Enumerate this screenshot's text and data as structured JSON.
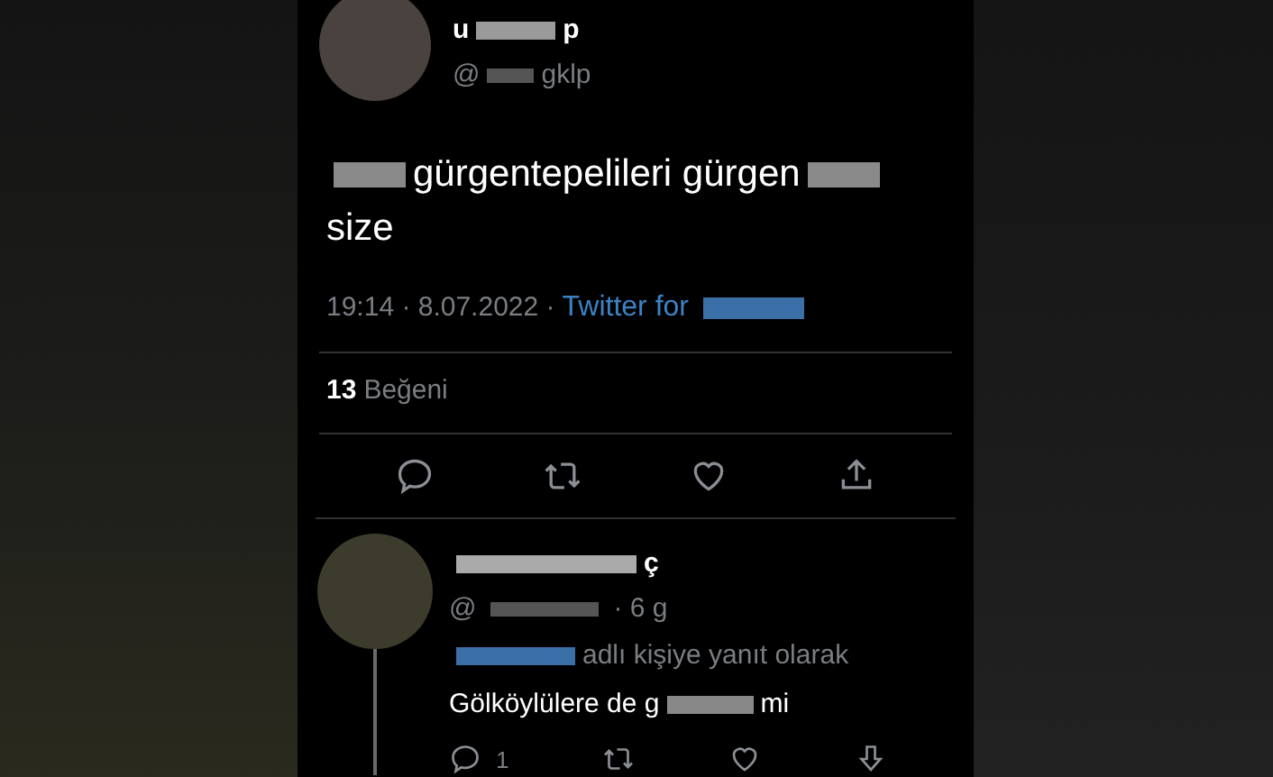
{
  "tweet": {
    "author": {
      "name": [
        {
          "kind": "text",
          "text": "u"
        },
        {
          "kind": "censor"
        },
        {
          "kind": "text",
          "text": "p"
        }
      ],
      "handle": [
        {
          "kind": "text",
          "text": "@"
        },
        {
          "kind": "censor"
        },
        {
          "kind": "text",
          "text": "gklp"
        }
      ]
    },
    "body": [
      {
        "kind": "censor"
      },
      {
        "kind": "text",
        "text": "gürgentepelileri gürgen"
      },
      {
        "kind": "censor"
      },
      {
        "kind": "break"
      },
      {
        "kind": "text",
        "text": "size"
      }
    ],
    "time": "19:14 · 8.07.2022 ·",
    "source": [
      {
        "kind": "link",
        "text": "Twitter for"
      },
      {
        "kind": "censor"
      }
    ],
    "likes_count": "13",
    "likes_label": "Beğeni"
  },
  "reply": {
    "name": [
      {
        "kind": "censor"
      },
      {
        "kind": "text",
        "text": "ç"
      }
    ],
    "handle": [
      {
        "kind": "text",
        "text": "@"
      },
      {
        "kind": "censor"
      }
    ],
    "age": "· 6 g",
    "reply_to": [
      {
        "kind": "censor"
      },
      {
        "kind": "text",
        "text": "adlı kişiye yanıt olarak"
      }
    ],
    "text": [
      {
        "kind": "text",
        "text": "Gölköylülere de g"
      },
      {
        "kind": "censor"
      },
      {
        "kind": "text",
        "text": "mi"
      }
    ],
    "reply_count": "1"
  }
}
